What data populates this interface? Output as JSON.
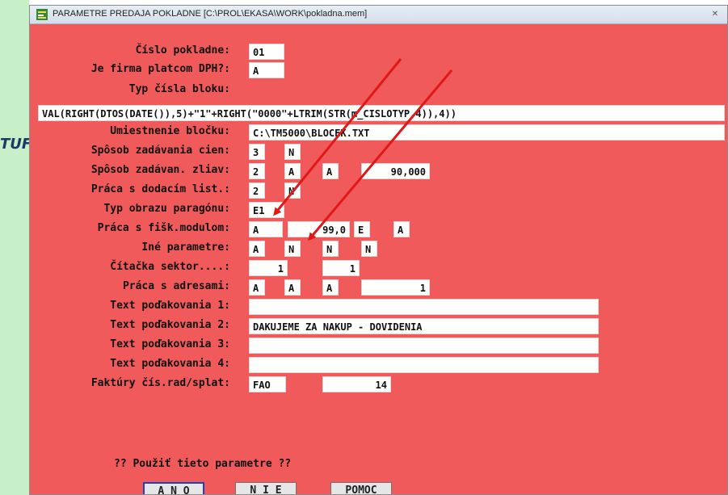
{
  "window": {
    "title": "PARAMETRE PREDAJA POKLADNE  [C:\\PROL\\EKASA\\WORK\\pokladna.mem]",
    "close": "✕"
  },
  "background": {
    "partial_text": "TUF"
  },
  "form": {
    "cislo_pokladne": {
      "label": "Číslo pokladne:",
      "value": "01"
    },
    "platca_dph": {
      "label": "Je firma platcom DPH?:",
      "value": "A"
    },
    "typ_cisla_bloku": {
      "label": "Typ čísla bloku:",
      "value": "VAL(RIGHT(DTOS(DATE()),5)+\"1\"+RIGHT(\"0000\"+LTRIM(STR(m_CISLOTYP,4)),4))"
    },
    "umiestnenie_blocku": {
      "label": "Umiestnenie bločku:",
      "value": "C:\\TM5000\\BLOCEK.TXT"
    },
    "sposob_cien": {
      "label": "Spôsob zadávania cien:",
      "v1": "3",
      "v2": "N"
    },
    "sposob_zliav": {
      "label": "Spôsob zadávan. zliav:",
      "v1": "2",
      "v2": "A",
      "v3": "A",
      "v4": "90,000"
    },
    "dodaci_list": {
      "label": "Práca s dodacím list.:",
      "v1": "2",
      "v2": "N"
    },
    "typ_obrazu": {
      "label": "Typ obrazu paragónu:",
      "value": "E1"
    },
    "fisk_modul": {
      "label": "Práca s fišk.modulom:",
      "v1": "A",
      "v2": "99,0",
      "v3": "E",
      "v4": "A"
    },
    "ine_parametre": {
      "label": "Iné parametre:",
      "v1": "A",
      "v2": "N",
      "v3": "N",
      "v4": "N"
    },
    "citacka": {
      "label": "Čítačka sektor....:",
      "v1": "1",
      "v2": "1"
    },
    "adresy": {
      "label": "Práca s adresami:",
      "v1": "A",
      "v2": "A",
      "v3": "A",
      "v4": "1"
    },
    "text1": {
      "label": "Text poďakovania 1:",
      "value": ""
    },
    "text2": {
      "label": "Text poďakovania 2:",
      "value": "DAKUJEME ZA NAKUP - DOVIDENIA"
    },
    "text3": {
      "label": "Text poďakovania 3:",
      "value": ""
    },
    "text4": {
      "label": "Text poďakovania 4:",
      "value": ""
    },
    "faktury": {
      "label": "Faktúry čís.rad/splat:",
      "v1": "FAO",
      "v2": "14"
    }
  },
  "prompt": {
    "question": "?? Použiť tieto parametre ??"
  },
  "buttons": {
    "ano": "A N O",
    "nie": "N I E",
    "pomoc": "POMOC"
  },
  "colors": {
    "form_bg": "#f05a5a",
    "arrow": "#e01818",
    "left_strip": "#c8f0c8"
  }
}
